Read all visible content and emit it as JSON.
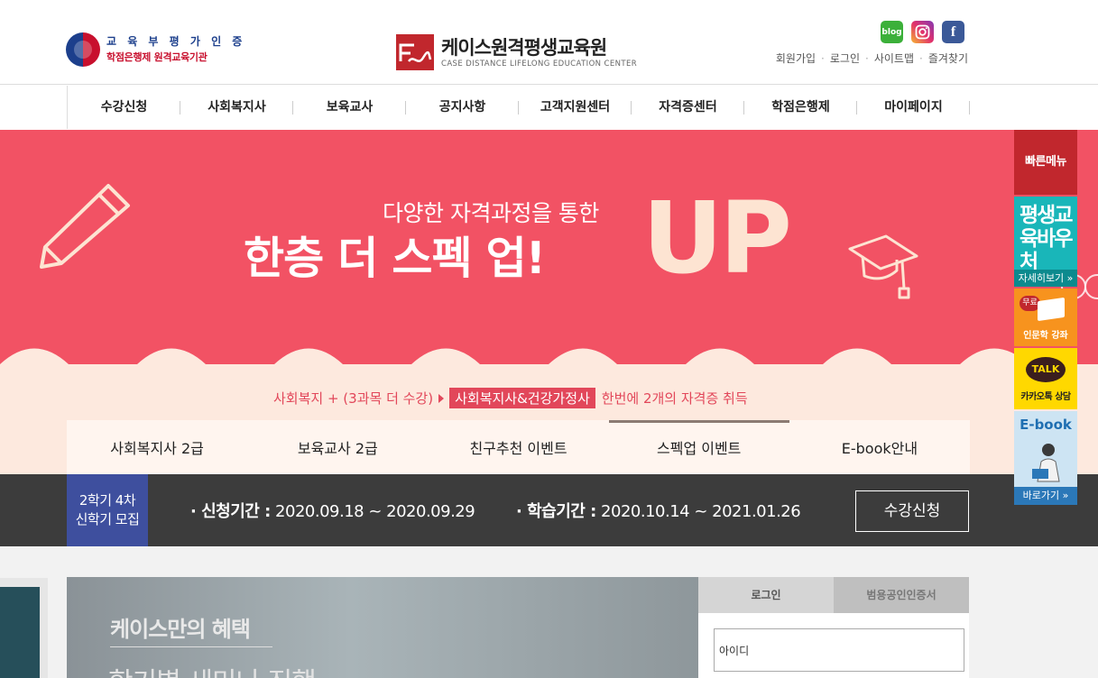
{
  "header": {
    "moe_line1": "교 육 부 평 가 인 증",
    "moe_line2": "학점은행제 원격교육기관",
    "brand_name": "케이스원격평생교육원",
    "brand_sub": "CASE DISTANCE LIFELONG EDUCATION CENTER",
    "social": {
      "blog": "blog",
      "facebook": "f"
    },
    "links": [
      "회원가입",
      "로그인",
      "사이트맵",
      "즐겨찾기"
    ],
    "link_sep": "·"
  },
  "gnb": [
    "수강신청",
    "사회복지사",
    "보육교사",
    "공지사항",
    "고객지원센터",
    "자격증센터",
    "학점은행제",
    "마이페이지"
  ],
  "banner": {
    "sub": "다양한 자격과정을 통한",
    "main": "한층 더 스펙 업!",
    "up": "UP",
    "promo_pre": "사회복지 + (3과목 더 수강)",
    "promo_hl": "사회복지사&건강가정사",
    "promo_post": "한번에 2개의 자격증 취득",
    "colors": {
      "red": "#f25264",
      "cream": "#fde9de"
    }
  },
  "tabs": {
    "items": [
      "사회복지사 2급",
      "보육교사 2급",
      "친구추천 이벤트",
      "스펙업 이벤트",
      "E-book안내"
    ],
    "active_index": 3
  },
  "strip": {
    "recruit_line1": "2학기 4차",
    "recruit_line2": "신학기 모집",
    "apply_label": "· 신청기간 :",
    "apply_dates": "2020.09.18 ~ 2020.09.29",
    "study_label": "· 학습기간 :",
    "study_dates": "2020.10.14 ~ 2021.01.26",
    "button": "수강신청"
  },
  "benefit": {
    "title": "케이스만의 혜택",
    "sub": "학기별 세미나 진행"
  },
  "login": {
    "tab_login": "로그인",
    "tab_cert": "범용공인인증서",
    "id_value": "아이디"
  },
  "quick": {
    "title": "빠른메뉴",
    "item1_title": "평생교육바우처",
    "item1_btn": "자세히보기 »",
    "item2_badge": "무료",
    "item2_label": "인문학 강좌",
    "item3_bubble": "TALK",
    "item3_label": "카카오톡 상담",
    "item4_title": "E-book",
    "item4_btn": "바로가기 »"
  }
}
